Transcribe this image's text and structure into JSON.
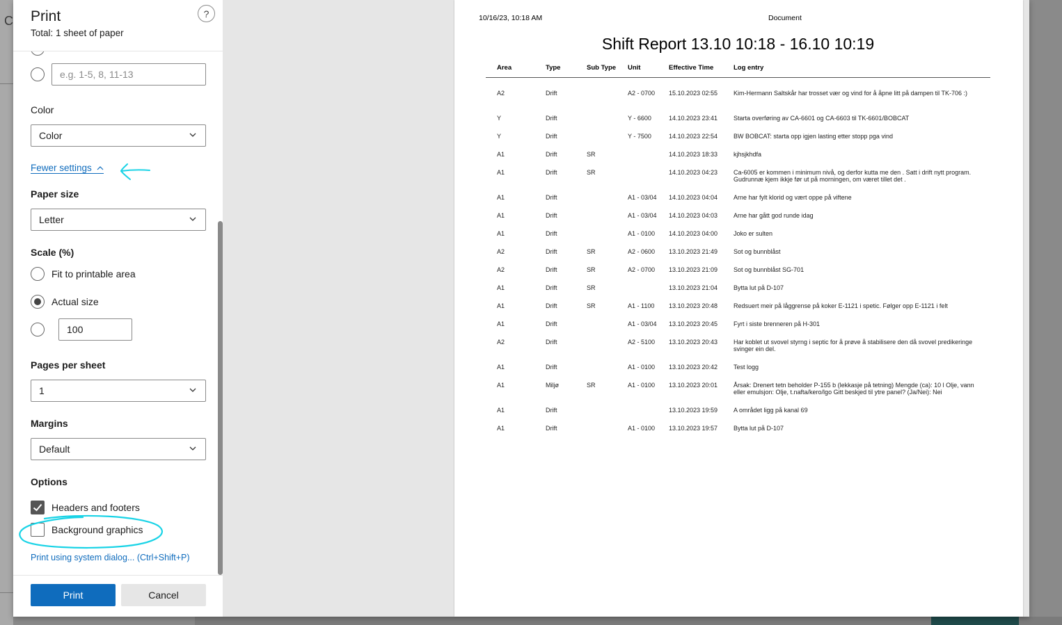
{
  "dialog": {
    "title": "Print",
    "subtitle": "Total: 1 sheet of paper",
    "help": "?"
  },
  "pages": {
    "custom_placeholder": "e.g. 1-5, 8, 11-13"
  },
  "color": {
    "label": "Color",
    "value": "Color"
  },
  "fewer_settings": "Fewer settings",
  "paper_size": {
    "label": "Paper size",
    "value": "Letter"
  },
  "scale": {
    "label": "Scale (%)",
    "fit_label": "Fit to printable area",
    "actual_label": "Actual size",
    "custom_value": "100",
    "selected": "actual"
  },
  "pages_per_sheet": {
    "label": "Pages per sheet",
    "value": "1"
  },
  "margins": {
    "label": "Margins",
    "value": "Default"
  },
  "options": {
    "label": "Options",
    "headers_footers": "Headers and footers",
    "headers_footers_checked": true,
    "background_graphics": "Background graphics",
    "background_graphics_checked": false
  },
  "system_dialog_link": "Print using system dialog... (Ctrl+Shift+P)",
  "buttons": {
    "print": "Print",
    "cancel": "Cancel"
  },
  "colors": {
    "accent": "#0f6cbd",
    "annotation": "#19d3e6"
  },
  "preview": {
    "date": "10/16/23, 10:18 AM",
    "doc_title": "Document",
    "report_title": "Shift Report 13.10 10:18 - 16.10 10:19",
    "columns": [
      "Area",
      "Type",
      "Sub Type",
      "Unit",
      "Effective Time",
      "Log entry"
    ],
    "rows": [
      [
        "A2",
        "Drift",
        "",
        "A2 - 0700",
        "15.10.2023 02:55",
        "Kim-Hermann Saltskår har trosset vær og vind for å åpne litt på dampen til TK-706 :)"
      ],
      [
        "Y",
        "Drift",
        "",
        "Y - 6600",
        "14.10.2023 23:41",
        "Starta overføring av CA-6601 og CA-6603 til TK-6601/BOBCAT"
      ],
      [
        "Y",
        "Drift",
        "",
        "Y - 7500",
        "14.10.2023 22:54",
        "BW BOBCAT: starta opp igjen lasting etter stopp pga vind"
      ],
      [
        "A1",
        "Drift",
        "SR",
        "",
        "14.10.2023 18:33",
        "kjhsjkhdfa"
      ],
      [
        "A1",
        "Drift",
        "SR",
        "",
        "14.10.2023 04:23",
        "Ca-6005 er kommen i minimum nivå, og derfor kutta me den . Satt i drift nytt program. Gudrunnæ kjem ikkje før ut på morningen, om været tillet det ."
      ],
      [
        "A1",
        "Drift",
        "",
        "A1 - 03/04",
        "14.10.2023 04:04",
        "Arne har fylt klorid og vært oppe på viftene"
      ],
      [
        "A1",
        "Drift",
        "",
        "A1 - 03/04",
        "14.10.2023 04:03",
        "Arne har gått god runde idag"
      ],
      [
        "A1",
        "Drift",
        "",
        "A1 - 0100",
        "14.10.2023 04:00",
        "Joko er sulten"
      ],
      [
        "A2",
        "Drift",
        "SR",
        "A2 - 0600",
        "13.10.2023 21:49",
        "Sot og bunnblåst"
      ],
      [
        "A2",
        "Drift",
        "SR",
        "A2 - 0700",
        "13.10.2023 21:09",
        "Sot og bunnblåst SG-701"
      ],
      [
        "A1",
        "Drift",
        "SR",
        "",
        "13.10.2023 21:04",
        "Bytta lut på D-107"
      ],
      [
        "A1",
        "Drift",
        "SR",
        "A1 - 1100",
        "13.10.2023 20:48",
        "Redsuert meir på låggrense på koker E-1121 i spetic. Følger opp E-1121 i felt"
      ],
      [
        "A1",
        "Drift",
        "",
        "A1 - 03/04",
        "13.10.2023 20:45",
        "Fyrt i siste brenneren på H-301"
      ],
      [
        "A2",
        "Drift",
        "",
        "A2 - 5100",
        "13.10.2023 20:43",
        "Har koblet ut svovel styrng i septic for å prøve å stabilisere den då svovel predikeringe svinger ein del."
      ],
      [
        "A1",
        "Drift",
        "",
        "A1 - 0100",
        "13.10.2023 20:42",
        "Test logg"
      ],
      [
        "A1",
        "Miljø",
        "SR",
        "A1 - 0100",
        "13.10.2023 20:01",
        "Årsak: Drenert tetn beholder P-155 b (lekkasje på tetning) Mengde (ca): 10 l Olje, vann eller emulsjon: Olje, t.nafta/kero/lgo Gitt beskjed til ytre panel? (Ja/Nei): Nei"
      ],
      [
        "A1",
        "Drift",
        "",
        "",
        "13.10.2023 19:59",
        "A området ligg på kanal 69"
      ],
      [
        "A1",
        "Drift",
        "",
        "A1 - 0100",
        "13.10.2023 19:57",
        "Bytta lut på D-107"
      ]
    ]
  }
}
